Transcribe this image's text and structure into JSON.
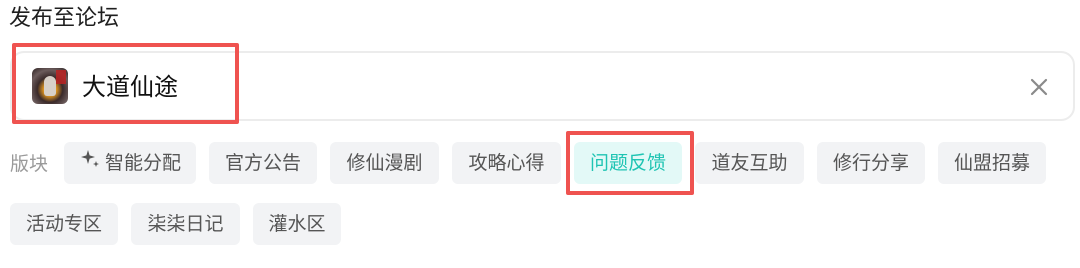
{
  "section_title": "发布至论坛",
  "forum": {
    "name": "大道仙途",
    "avatar_icon": "forum-avatar-icon",
    "clear_icon": "close-icon"
  },
  "block_label": "版块",
  "tags": [
    {
      "label": "智能分配",
      "icon": "sparkle-icon",
      "active": false
    },
    {
      "label": "官方公告",
      "active": false
    },
    {
      "label": "修仙漫剧",
      "active": false
    },
    {
      "label": "攻略心得",
      "active": false
    },
    {
      "label": "问题反馈",
      "active": true
    },
    {
      "label": "道友互助",
      "active": false
    },
    {
      "label": "修行分享",
      "active": false
    },
    {
      "label": "仙盟招募",
      "active": false
    },
    {
      "label": "活动专区",
      "active": false
    },
    {
      "label": "柒柒日记",
      "active": false
    },
    {
      "label": "灌水区",
      "active": false
    }
  ],
  "colors": {
    "highlight": "#ef5350",
    "active_text": "#1fc4b3",
    "active_bg": "#e3f9f7",
    "tag_bg": "#f2f3f5"
  }
}
